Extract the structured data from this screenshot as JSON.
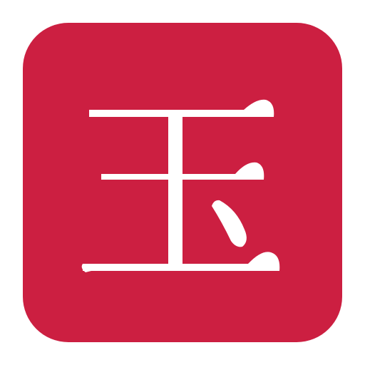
{
  "icon": {
    "name": "jade-character-app-icon",
    "glyph": "玉",
    "background_color": "#cc1f41",
    "glyph_color": "#ffffff"
  }
}
